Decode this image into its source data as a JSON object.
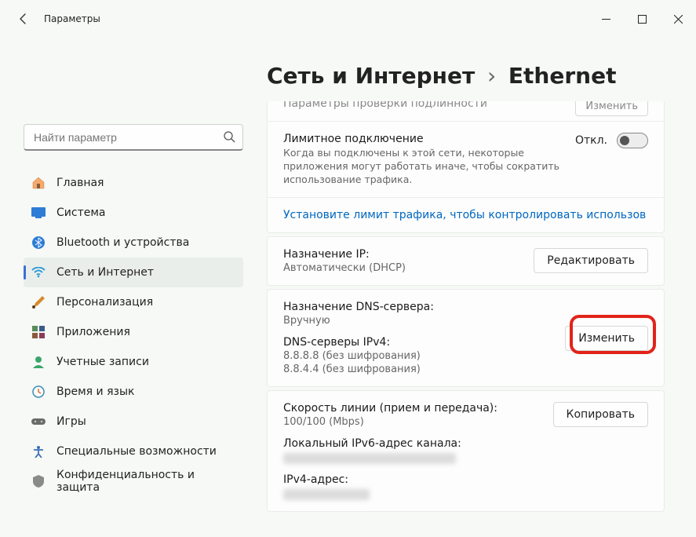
{
  "window": {
    "title": "Параметры"
  },
  "search": {
    "placeholder": "Найти параметр"
  },
  "nav": {
    "items": [
      {
        "label": "Главная"
      },
      {
        "label": "Система"
      },
      {
        "label": "Bluetooth и устройства"
      },
      {
        "label": "Сеть и Интернет"
      },
      {
        "label": "Персонализация"
      },
      {
        "label": "Приложения"
      },
      {
        "label": "Учетные записи"
      },
      {
        "label": "Время и язык"
      },
      {
        "label": "Игры"
      },
      {
        "label": "Специальные возможности"
      },
      {
        "label": "Конфиденциальность и защита"
      }
    ]
  },
  "breadcrumb": {
    "root": "Сеть и Интернет",
    "leaf": "Ethernet"
  },
  "settings": {
    "auth": {
      "title": "Параметры проверки подлинности",
      "button": "Изменить"
    },
    "metered": {
      "title": "Лимитное подключение",
      "desc": "Когда вы подключены к этой сети, некоторые приложения могут работать иначе, чтобы сократить использование трафика.",
      "state_label": "Откл."
    },
    "limit_link": "Установите лимит трафика, чтобы контролировать использов",
    "ip": {
      "label": "Назначение IP:",
      "value": "Автоматически (DHCP)",
      "button": "Редактировать"
    },
    "dns": {
      "label": "Назначение DNS-сервера:",
      "value": "Вручную",
      "ipv4_label": "DNS-серверы IPv4:",
      "ipv4_v1": "8.8.8.8 (без шифрования)",
      "ipv4_v2": "8.8.4.4 (без шифрования)",
      "button": "Изменить"
    },
    "speed": {
      "label": "Скорость линии (прием и передача):",
      "value": "100/100 (Mbps)",
      "ipv6_label": "Локальный IPv6-адрес канала:",
      "ipv4_addr_label": "IPv4-адрес:",
      "button": "Копировать"
    }
  }
}
